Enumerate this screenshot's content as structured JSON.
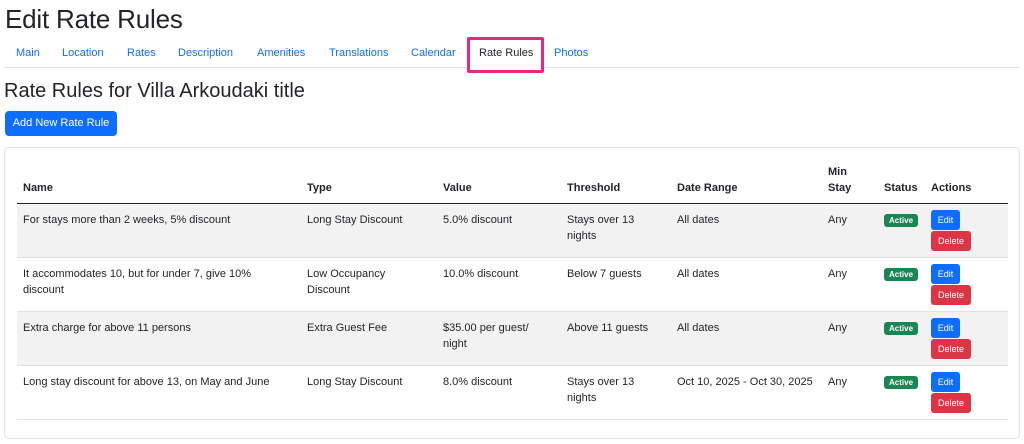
{
  "page": {
    "title": "Edit Rate Rules"
  },
  "tabs": [
    {
      "label": "Main"
    },
    {
      "label": "Location"
    },
    {
      "label": "Rates"
    },
    {
      "label": "Description"
    },
    {
      "label": "Amenities"
    },
    {
      "label": "Translations"
    },
    {
      "label": "Calendar"
    },
    {
      "label": "Rate Rules",
      "active": true
    },
    {
      "label": "Photos"
    }
  ],
  "section": {
    "title": "Rate Rules for Villa Arkoudaki title"
  },
  "add_button": {
    "label": "Add New Rate Rule"
  },
  "table": {
    "headers": {
      "name": "Name",
      "type": "Type",
      "value": "Value",
      "threshold": "Threshold",
      "date_range": "Date Range",
      "min_stay": "Min Stay",
      "status": "Status",
      "actions": "Actions"
    },
    "rows": [
      {
        "name": "For stays more than 2 weeks, 5% discount",
        "type": "Long Stay Discount",
        "value": "5.0% discount",
        "threshold": "Stays over 13 nights",
        "date_range": "All dates",
        "min_stay": "Any",
        "status": "Active",
        "edit": "Edit",
        "delete": "Delete"
      },
      {
        "name": "It accommodates 10, but for under 7, give 10% discount",
        "type": "Low Occupancy Discount",
        "value": "10.0% discount",
        "threshold": "Below 7 guests",
        "date_range": "All dates",
        "min_stay": "Any",
        "status": "Active",
        "edit": "Edit",
        "delete": "Delete"
      },
      {
        "name": "Extra charge for above 11 persons",
        "type": "Extra Guest Fee",
        "value": "$35.00 per guest/ night",
        "threshold": "Above 11 guests",
        "date_range": "All dates",
        "min_stay": "Any",
        "status": "Active",
        "edit": "Edit",
        "delete": "Delete"
      },
      {
        "name": "Long stay discount for above 13, on May and June",
        "type": "Long Stay Discount",
        "value": "8.0% discount",
        "threshold": "Stays over 13 nights",
        "date_range": "Oct 10, 2025 - Oct 30, 2025",
        "min_stay": "Any",
        "status": "Active",
        "edit": "Edit",
        "delete": "Delete"
      }
    ]
  },
  "colors": {
    "primary": "#0d6efd",
    "danger": "#dc3545",
    "success": "#198754",
    "highlight": "#e8287e"
  }
}
